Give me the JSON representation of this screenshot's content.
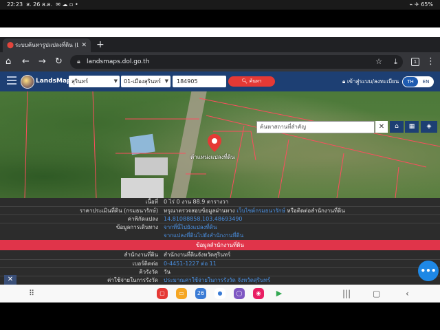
{
  "status": {
    "time": "22:23",
    "date": "ส. 26 ส.ค.",
    "icons": "✉ ☁ ▫ •",
    "right": "⌁ ✈ 65%"
  },
  "browser": {
    "tab_title": "ระบบค้นหารูปแปลงที่ดิน (Lan",
    "url": "landsmaps.dol.go.th",
    "tab_count": "1"
  },
  "app": {
    "brand": "LandsMaps",
    "province": "สุรินทร์",
    "district": "01-เมืองสุรินทร์",
    "parcel_number": "184905",
    "search_label": "ค้นหา",
    "login_label": "เข้าสู่ระบบ/ลงทะเบียน",
    "lang_th": "TH",
    "lang_en": "EN"
  },
  "map": {
    "search_placeholder": "ค้นหาสถานที่สำคัญ",
    "marker_label": "ตำแหน่งแปลงที่ดิน"
  },
  "info": {
    "area_label": "เนื้อที่",
    "area_value": "0 ไร่ 0 งาน 88.9 ตารางวา",
    "price_label": "ราคาประเมินที่ดิน (กรมธนารักษ์)",
    "price_text": "ทรุณาตรวจสอบข้อมูลผ่านทาง",
    "price_link": "เว็บไซต์กรมธนารักษ์",
    "price_suffix": "หรือติดต่อสำนักงานที่ดิน",
    "coord_label": "ค่าพิกัดแปลง",
    "coord_value": "14.81088858,103.48693490",
    "route_label": "ข้อมูลการเดินทาง",
    "route_link1": "จากที่นี่ไปยังแปลงที่ดิน",
    "route_link2": "จากแปลงที่ดินไปยังสำนักงานที่ดิน",
    "office_section": "ข้อมูลสำนักงานที่ดิน",
    "office_label": "สำนักงานที่ดิน",
    "office_value": "สำนักงานที่ดินจังหวัดสุรินทร์",
    "phone_label": "เบอร์ติดต่อ",
    "phone_value": "0-4451-1227 ต่อ 11",
    "queue_label": "คิวรังวัด",
    "queue_value": "วัน",
    "cost_label": "ค่าใช้จ่ายในการรังวัด",
    "cost_value": "ประมาณค่าใช้จ่ายในการรังวัด จังหวัดสุรินทร์"
  },
  "fab_label": "•••"
}
